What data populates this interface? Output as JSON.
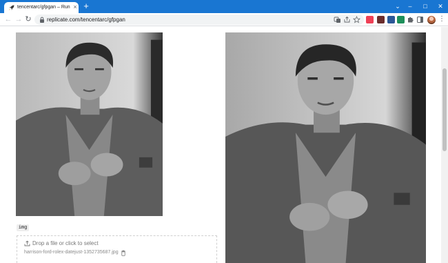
{
  "browser": {
    "tab": {
      "title": "tencentarc/gfpgan – Run with an API",
      "close_glyph": "×",
      "favicon": "rocket-icon"
    },
    "new_tab_glyph": "+",
    "window_controls": {
      "chevron": "⌄",
      "minimize": "–",
      "maximize": "□",
      "close": "✕"
    },
    "nav": {
      "back": "←",
      "forward": "→",
      "reload": "↻"
    },
    "address_bar": {
      "url": "replicate.com/tencentarc/gfpgan"
    },
    "omnibox_icons": [
      "translate-icon",
      "share-icon",
      "star-icon"
    ],
    "extensions": [
      "pocket-icon",
      "shield-extension-icon",
      "extension-icon-3",
      "extension-icon-4",
      "puzzle-icon",
      "side-panel-icon"
    ],
    "menu_glyph": "⋮",
    "colors": {
      "chrome_blue": "#1976d2",
      "omnibox_bg": "#f1f3f4"
    }
  },
  "page": {
    "input_section": {
      "image_alt": "input photo",
      "field_label": "img",
      "dropzone_text": "Drop a file or click to select",
      "file_name": "harrison-ford-rolex-datejust-1352735687.jpg"
    },
    "output_section": {
      "image_alt": "restored output photo"
    }
  }
}
